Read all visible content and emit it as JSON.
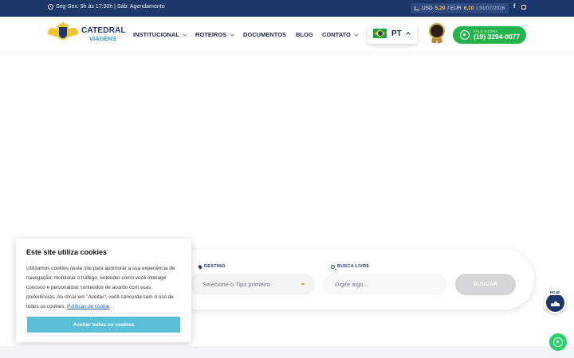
{
  "topbar": {
    "hours": "Seg-Sex: 9h às 17:30h | Sáb: Agendamento",
    "usd_label": "USD",
    "usd_value": "5,29",
    "eur_label": "/ EUR",
    "eur_value": "6,10",
    "date": "| 31/07/2026",
    "facebook": "f"
  },
  "header": {
    "logo_line1": "CATEDRAL",
    "logo_line2": "VIAGENS",
    "nav": [
      {
        "label": "INSTITUCIONAL"
      },
      {
        "label": "ROTEIROS"
      },
      {
        "label": "DOCUMENTOS"
      },
      {
        "label": "BLOG"
      },
      {
        "label": "CONTATO"
      }
    ],
    "language": "PT",
    "whatsapp_small": "FALE AGORA",
    "whatsapp_phone": "(19) 3294-0077"
  },
  "search": {
    "destino_label": "DESTINO",
    "destino_placeholder": "Selecione o Tipo primeiro",
    "busca_label": "BUSCA LIVRE",
    "busca_placeholder": "Digite algo...",
    "button": "BUSCAR"
  },
  "cookie": {
    "title": "Este site utiliza cookies",
    "body": "Utilizamos cookies neste site para aprimorar a sua experiência de navegação, monitorar o tráfego, entender como você interage conosco e personalizar conteúdos de acordo com suas preferências. Ao clicar em \"Aceitar\", você concorda com o uso de todos os cookies.",
    "link": "Políticas de cookie",
    "accept": "Aceitar todos os cookies"
  },
  "floating": {
    "hoje": "HOJE"
  },
  "colors": {
    "navy": "#1c3769",
    "gold": "#f2c12e",
    "whatsapp": "#25b34b",
    "accept": "#5bbfd8"
  }
}
